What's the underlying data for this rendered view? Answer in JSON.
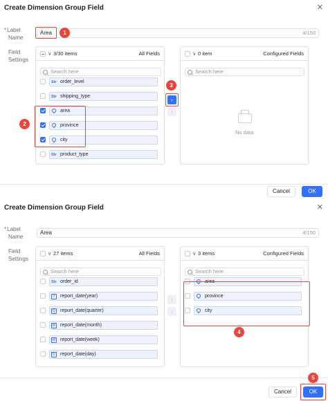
{
  "top": {
    "title": "Create Dimension Group Field",
    "label_name_line1": "Label",
    "label_name_line2": "Name",
    "label_value": "Area",
    "label_count": "4/150",
    "field_settings_line1": "Field",
    "field_settings_line2": "Settings",
    "left": {
      "count": "3/30 items",
      "title": "All Fields",
      "search_placeholder": "Search here",
      "items": [
        {
          "label": "order_level",
          "icon": "Str",
          "checked": false
        },
        {
          "label": "shipping_type",
          "icon": "Str",
          "checked": false
        },
        {
          "label": "area",
          "icon": "geo",
          "checked": true
        },
        {
          "label": "province",
          "icon": "geo",
          "checked": true
        },
        {
          "label": "city",
          "icon": "geo",
          "checked": true
        },
        {
          "label": "product_type",
          "icon": "Str",
          "checked": false
        }
      ]
    },
    "right": {
      "count": "0 item",
      "title": "Configured Fields",
      "search_placeholder": "Search here",
      "empty_text": "No data"
    },
    "cancel": "Cancel",
    "ok": "OK",
    "badges": [
      "1",
      "2",
      "3"
    ]
  },
  "bottom": {
    "title": "Create Dimension Group Field",
    "label_name_line1": "Label",
    "label_name_line2": "Name",
    "label_value": "Area",
    "label_count": "4/150",
    "field_settings_line1": "Field",
    "field_settings_line2": "Settings",
    "left": {
      "count": "27 items",
      "title": "All Fields",
      "search_placeholder": "Search here",
      "items": [
        {
          "label": "order_id",
          "icon": "Str"
        },
        {
          "label": "report_date(year)",
          "icon": "Y"
        },
        {
          "label": "report_date(quarter)",
          "icon": "Q"
        },
        {
          "label": "report_date(month)",
          "icon": "M"
        },
        {
          "label": "report_date(week)",
          "icon": "W"
        },
        {
          "label": "report_date(day)",
          "icon": "D"
        }
      ]
    },
    "right": {
      "count": "3 items",
      "title": "Configured Fields",
      "search_placeholder": "Search here",
      "items": [
        {
          "label": "area"
        },
        {
          "label": "province"
        },
        {
          "label": "city"
        }
      ]
    },
    "cancel": "Cancel",
    "ok": "OK",
    "badges": [
      "4",
      "5"
    ]
  },
  "colors": {
    "accent": "#3370ff",
    "annotation": "#e8463b"
  }
}
